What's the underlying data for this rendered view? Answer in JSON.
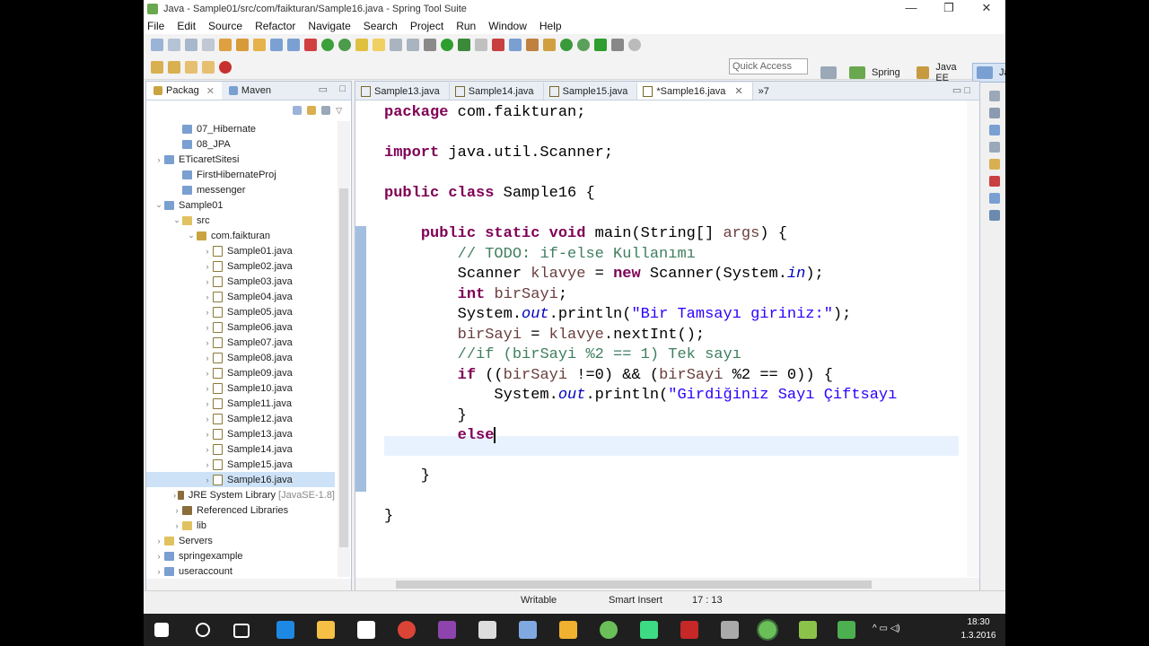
{
  "window": {
    "title": "Java - Sample01/src/com/faikturan/Sample16.java - Spring Tool Suite",
    "min": "—",
    "restore": "❐",
    "close": "✕"
  },
  "menu": [
    "File",
    "Edit",
    "Source",
    "Refactor",
    "Navigate",
    "Search",
    "Project",
    "Run",
    "Window",
    "Help"
  ],
  "quick_access": {
    "placeholder": "Quick Access"
  },
  "perspectives": [
    {
      "label": "Spring"
    },
    {
      "label": "Java EE"
    },
    {
      "label": "Java"
    }
  ],
  "package_explorer": {
    "tabs": [
      {
        "label": "Packag"
      },
      {
        "label": "Maven"
      }
    ],
    "items": [
      {
        "label": "07_Hibernate",
        "arrow": "",
        "icon": "proj"
      },
      {
        "label": "08_JPA",
        "arrow": "",
        "icon": "proj"
      },
      {
        "label": "ETicaretSitesi",
        "arrow": "›",
        "icon": "proj"
      },
      {
        "label": "FirstHibernateProj",
        "arrow": "",
        "icon": "proj"
      },
      {
        "label": "messenger",
        "arrow": "",
        "icon": "proj"
      },
      {
        "label": "Sample01",
        "arrow": "⌄",
        "icon": "proj"
      },
      {
        "label": "src",
        "arrow": "⌄",
        "icon": "folder"
      },
      {
        "label": "com.faikturan",
        "arrow": "⌄",
        "icon": "pkg"
      },
      {
        "label": "Sample01.java",
        "arrow": "›",
        "icon": "java"
      },
      {
        "label": "Sample02.java",
        "arrow": "›",
        "icon": "java"
      },
      {
        "label": "Sample03.java",
        "arrow": "›",
        "icon": "java"
      },
      {
        "label": "Sample04.java",
        "arrow": "›",
        "icon": "java"
      },
      {
        "label": "Sample05.java",
        "arrow": "›",
        "icon": "java"
      },
      {
        "label": "Sample06.java",
        "arrow": "›",
        "icon": "java"
      },
      {
        "label": "Sample07.java",
        "arrow": "›",
        "icon": "java"
      },
      {
        "label": "Sample08.java",
        "arrow": "›",
        "icon": "java"
      },
      {
        "label": "Sample09.java",
        "arrow": "›",
        "icon": "java"
      },
      {
        "label": "Sample10.java",
        "arrow": "›",
        "icon": "java"
      },
      {
        "label": "Sample11.java",
        "arrow": "›",
        "icon": "java"
      },
      {
        "label": "Sample12.java",
        "arrow": "›",
        "icon": "java"
      },
      {
        "label": "Sample13.java",
        "arrow": "›",
        "icon": "java"
      },
      {
        "label": "Sample14.java",
        "arrow": "›",
        "icon": "java"
      },
      {
        "label": "Sample15.java",
        "arrow": "›",
        "icon": "java"
      },
      {
        "label": "Sample16.java",
        "arrow": "›",
        "icon": "java",
        "selected": true
      },
      {
        "label": "JRE System Library",
        "suffix": "[JavaSE-1.8]",
        "arrow": "›",
        "icon": "lib"
      },
      {
        "label": "Referenced Libraries",
        "arrow": "›",
        "icon": "lib"
      },
      {
        "label": "lib",
        "arrow": "›",
        "icon": "folder"
      },
      {
        "label": "Servers",
        "arrow": "›",
        "icon": "folder"
      },
      {
        "label": "springexample",
        "arrow": "›",
        "icon": "proj"
      },
      {
        "label": "useraccount",
        "arrow": "›",
        "icon": "proj"
      }
    ]
  },
  "editor": {
    "tabs": [
      {
        "label": "Sample13.java"
      },
      {
        "label": "Sample14.java"
      },
      {
        "label": "Sample15.java"
      },
      {
        "label": "*Sample16.java",
        "active": true
      },
      {
        "label": "»7"
      }
    ],
    "lines": [
      [
        [
          "kw",
          "package"
        ],
        [
          "plain",
          " com.faikturan;"
        ]
      ],
      [],
      [
        [
          "kw",
          "import"
        ],
        [
          "plain",
          " java.util.Scanner;"
        ]
      ],
      [],
      [
        [
          "kw",
          "public class"
        ],
        [
          "plain",
          " Sample16 {"
        ]
      ],
      [],
      [
        [
          "plain",
          "    "
        ],
        [
          "kw",
          "public static void"
        ],
        [
          "plain",
          " main(String[] "
        ],
        [
          "var",
          "args"
        ],
        [
          "plain",
          ") {"
        ]
      ],
      [
        [
          "plain",
          "        "
        ],
        [
          "cm",
          "// TODO: if-else Kullanımı"
        ]
      ],
      [
        [
          "plain",
          "        Scanner "
        ],
        [
          "var",
          "klavye"
        ],
        [
          "plain",
          " = "
        ],
        [
          "kw",
          "new"
        ],
        [
          "plain",
          " Scanner(System."
        ],
        [
          "fld",
          "in"
        ],
        [
          "plain",
          ");"
        ]
      ],
      [
        [
          "plain",
          "        "
        ],
        [
          "kw",
          "int"
        ],
        [
          "plain",
          " "
        ],
        [
          "var",
          "birSayi"
        ],
        [
          "plain",
          ";"
        ]
      ],
      [
        [
          "plain",
          "        System."
        ],
        [
          "fld",
          "out"
        ],
        [
          "plain",
          ".println("
        ],
        [
          "st",
          "\"Bir Tamsayı giriniz:\""
        ],
        [
          "plain",
          ");"
        ]
      ],
      [
        [
          "plain",
          "        "
        ],
        [
          "var",
          "birSayi"
        ],
        [
          "plain",
          " = "
        ],
        [
          "var",
          "klavye"
        ],
        [
          "plain",
          ".nextInt();"
        ]
      ],
      [
        [
          "plain",
          "        "
        ],
        [
          "cm",
          "//if (birSayi %2 == 1) Tek sayı"
        ]
      ],
      [
        [
          "plain",
          "        "
        ],
        [
          "kw",
          "if"
        ],
        [
          "plain",
          " (("
        ],
        [
          "var",
          "birSayi"
        ],
        [
          "plain",
          " !=0) && ("
        ],
        [
          "var",
          "birSayi"
        ],
        [
          "plain",
          " %2 == 0)) {"
        ]
      ],
      [
        [
          "plain",
          "            System."
        ],
        [
          "fld",
          "out"
        ],
        [
          "plain",
          ".println("
        ],
        [
          "st",
          "\"Girdiğiniz Sayı Çiftsayı"
        ]
      ],
      [
        [
          "plain",
          "        }"
        ]
      ],
      [
        [
          "plain",
          "        "
        ],
        [
          "kw",
          "else"
        ]
      ],
      [],
      [
        [
          "plain",
          "    }"
        ]
      ],
      [],
      [
        [
          "plain",
          "}"
        ]
      ]
    ]
  },
  "status": {
    "writable": "Writable",
    "mode": "Smart Insert",
    "position": "17 : 13"
  },
  "taskbar": {
    "time": "18:30",
    "date": "1.3.2016"
  }
}
